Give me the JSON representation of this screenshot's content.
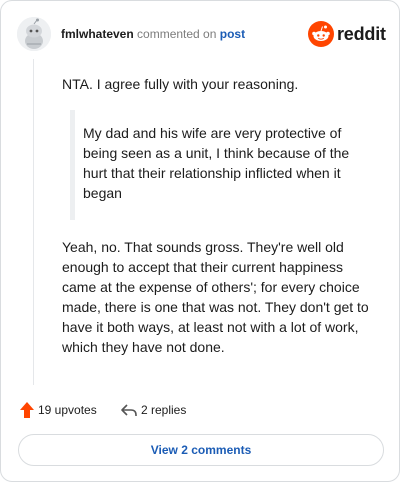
{
  "header": {
    "username": "fmlwhateven",
    "action_text": "commented on",
    "post_link": "post",
    "logo_text": "reddit"
  },
  "comment": {
    "paragraph1": "NTA. I agree fully with your reasoning.",
    "quote": "My dad and his wife are very protective of being seen as a unit, I think because of the hurt that their relationship inflicted when it began",
    "paragraph2": "Yeah, no. That sounds gross. They're well old enough to accept that their current happiness came at the expense of others'; for every choice made, there is one that was not. They don't get to have it both ways, at least not with a lot of work, which they have not done."
  },
  "actions": {
    "upvotes_label": "19 upvotes",
    "replies_label": "2 replies"
  },
  "footer": {
    "view_comments_label": "View 2 comments"
  },
  "colors": {
    "upvote": "#ff4500",
    "reddit_orange": "#ff4500",
    "link_blue": "#1b5cb5"
  },
  "icons": [
    "snoo-avatar-icon",
    "reddit-logo-icon",
    "upvote-arrow-icon",
    "reply-arrow-icon"
  ]
}
